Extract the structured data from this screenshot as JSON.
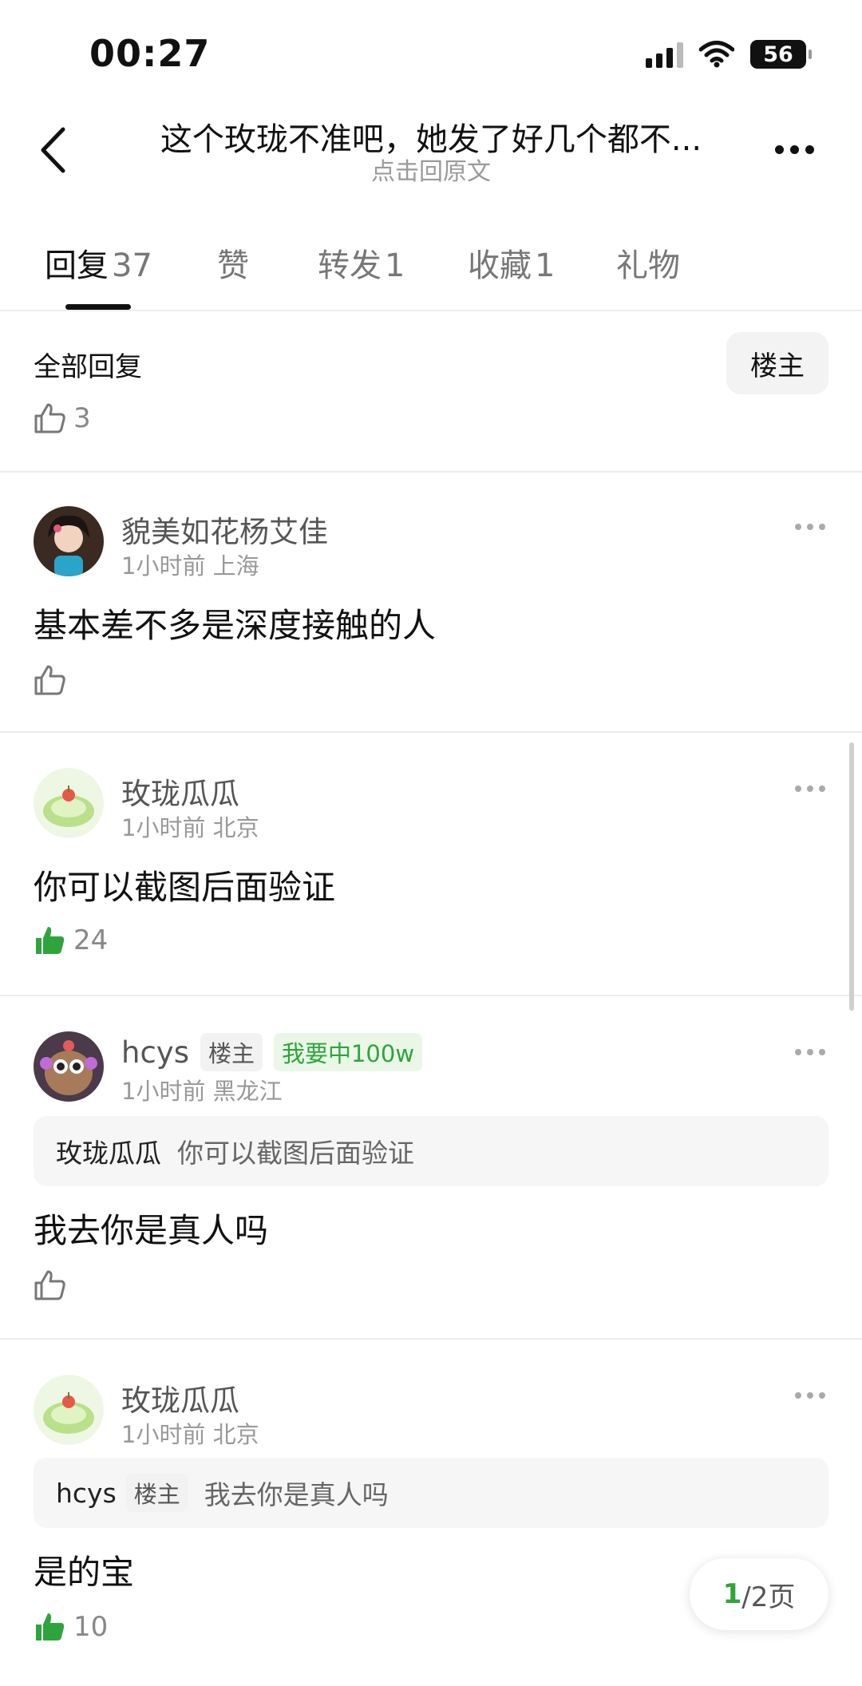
{
  "status_bar": {
    "time": "00:27",
    "battery": "56"
  },
  "nav": {
    "title": "这个玫珑不准吧，她发了好几个都不...",
    "subtitle": "点击回原文"
  },
  "tabs": [
    {
      "label": "回复",
      "count": "37"
    },
    {
      "label": "赞",
      "count": ""
    },
    {
      "label": "转发",
      "count": "1"
    },
    {
      "label": "收藏",
      "count": "1"
    },
    {
      "label": "礼物",
      "count": ""
    }
  ],
  "section": {
    "all_replies": "全部回复",
    "owner_filter": "楼主",
    "op_like_count": "3"
  },
  "comments": [
    {
      "name": "貌美如花杨艾佳",
      "time": "1小时前",
      "location": "上海",
      "text": "基本差不多是深度接触的人",
      "likes": ""
    },
    {
      "name": "玫珑瓜瓜",
      "time": "1小时前",
      "location": "北京",
      "text": "你可以截图后面验证",
      "likes": "24"
    },
    {
      "name": "hcys",
      "badge_op": "楼主",
      "badge_green": "我要中100w",
      "time": "1小时前",
      "location": "黑龙江",
      "quote_name": "玫珑瓜瓜",
      "quote_text": "你可以截图后面验证",
      "text": "我去你是真人吗",
      "likes": ""
    },
    {
      "name": "玫珑瓜瓜",
      "time": "1小时前",
      "location": "北京",
      "quote_name": "hcys",
      "quote_badge": "楼主",
      "quote_text": "我去你是真人吗",
      "text": "是的宝",
      "likes": "10"
    }
  ],
  "pager": {
    "current": "1",
    "total": "/2页"
  },
  "colors": {
    "accent_green": "#2fa43c",
    "divider": "#ececec",
    "text_muted": "#999999"
  },
  "icons": [
    "back-arrow-icon",
    "more-dots-icon",
    "thumb-up-icon",
    "thumb-up-filled-icon",
    "wifi-icon",
    "signal-icon",
    "battery-icon"
  ]
}
